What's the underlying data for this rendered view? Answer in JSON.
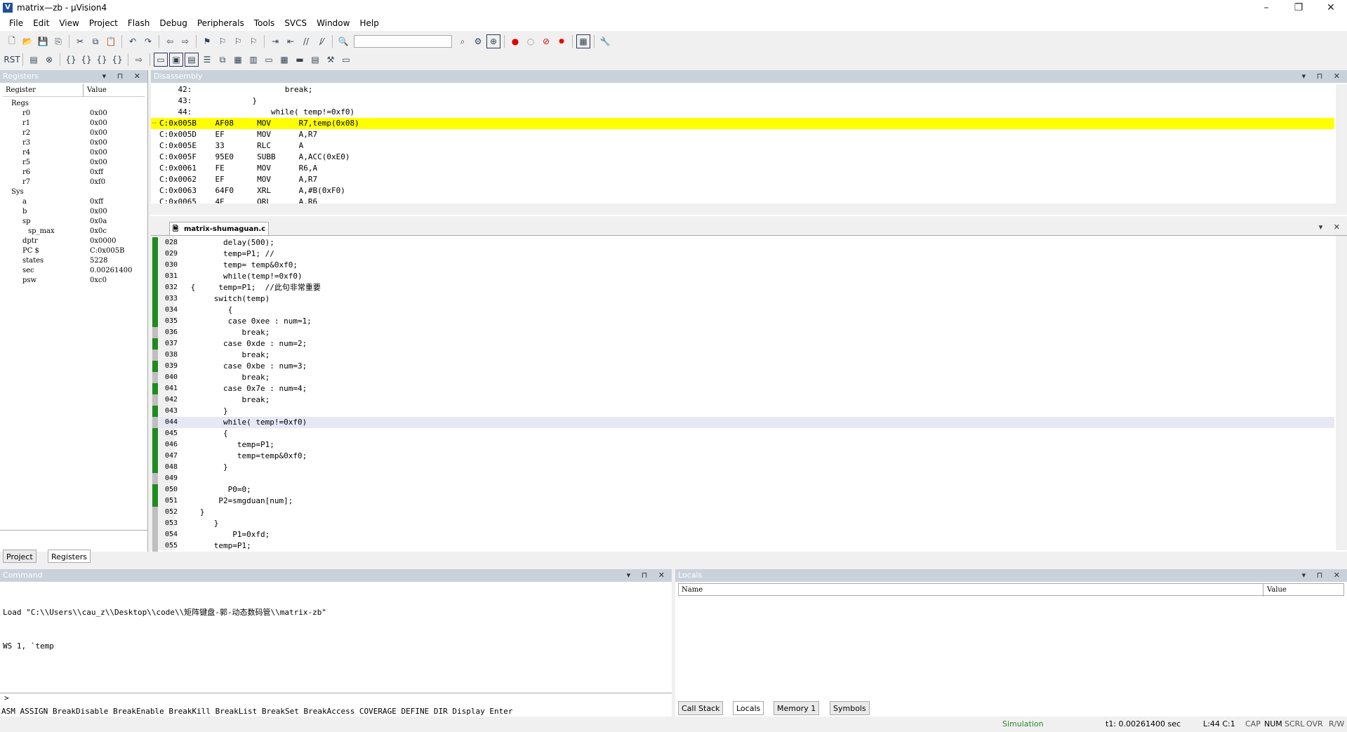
{
  "window": {
    "title": "matrix—zb - µVision4"
  },
  "menu": [
    "File",
    "Edit",
    "View",
    "Project",
    "Flash",
    "Debug",
    "Peripherals",
    "Tools",
    "SVCS",
    "Window",
    "Help"
  ],
  "registers": {
    "header": "Registers",
    "col_register": "Register",
    "col_value": "Value",
    "rows": [
      {
        "name": "Regs",
        "value": "",
        "indent": 1,
        "group": true
      },
      {
        "name": "r0",
        "value": "0x00",
        "indent": 3
      },
      {
        "name": "r1",
        "value": "0x00",
        "indent": 3
      },
      {
        "name": "r2",
        "value": "0x00",
        "indent": 3
      },
      {
        "name": "r3",
        "value": "0x00",
        "indent": 3
      },
      {
        "name": "r4",
        "value": "0x00",
        "indent": 3
      },
      {
        "name": "r5",
        "value": "0x00",
        "indent": 3
      },
      {
        "name": "r6",
        "value": "0xff",
        "indent": 3
      },
      {
        "name": "r7",
        "value": "0xf0",
        "indent": 3
      },
      {
        "name": "Sys",
        "value": "",
        "indent": 1,
        "group": true
      },
      {
        "name": "a",
        "value": "0xff",
        "indent": 3
      },
      {
        "name": "b",
        "value": "0x00",
        "indent": 3
      },
      {
        "name": "sp",
        "value": "0x0a",
        "indent": 3
      },
      {
        "name": "sp_max",
        "value": "0x0c",
        "indent": 4
      },
      {
        "name": "dptr",
        "value": "0x0000",
        "indent": 3
      },
      {
        "name": "PC  $",
        "value": "C:0x005B",
        "indent": 3
      },
      {
        "name": "states",
        "value": "5228",
        "indent": 3
      },
      {
        "name": "sec",
        "value": "0.00261400",
        "indent": 3
      },
      {
        "name": "psw",
        "value": "0xc0",
        "indent": 3
      }
    ],
    "tabs": [
      "Project",
      "Registers"
    ]
  },
  "disassembly": {
    "header": "Disassembly",
    "lines": [
      {
        "text": "    42:                    break;",
        "hl": false
      },
      {
        "text": "    43:             }",
        "hl": false
      },
      {
        "text": "    44:                 while( temp!=0xf0)",
        "hl": false
      },
      {
        "text": "C:0x005B    AF08     MOV      R7,temp(0x08)",
        "hl": true
      },
      {
        "text": "C:0x005D    EF       MOV      A,R7",
        "hl": false
      },
      {
        "text": "C:0x005E    33       RLC      A",
        "hl": false
      },
      {
        "text": "C:0x005F    95E0     SUBB     A,ACC(0xE0)",
        "hl": false
      },
      {
        "text": "C:0x0061    FE       MOV      R6,A",
        "hl": false
      },
      {
        "text": "C:0x0062    EF       MOV      A,R7",
        "hl": false
      },
      {
        "text": "C:0x0063    64F0     XRL      A,#B(0xF0)",
        "hl": false
      },
      {
        "text": "C:0x0065    4E       ORL      A,R6",
        "hl": false
      }
    ]
  },
  "editor": {
    "tab": "matrix-shumaguan.c",
    "lines": [
      {
        "n": "028",
        "code": "        delay(500);"
      },
      {
        "n": "029",
        "code": "        temp=P1; //"
      },
      {
        "n": "030",
        "code": "        temp= temp&0xf0;"
      },
      {
        "n": "031",
        "code": "        while(temp!=0xf0)"
      },
      {
        "n": "032",
        "code": " {     temp=P1;  //此句非常重要"
      },
      {
        "n": "033",
        "code": "      switch(temp)"
      },
      {
        "n": "034",
        "code": "         {"
      },
      {
        "n": "035",
        "code": "         case 0xee : num=1;"
      },
      {
        "n": "036",
        "code": "            break;"
      },
      {
        "n": "037",
        "code": "        case 0xde : num=2;"
      },
      {
        "n": "038",
        "code": "            break;"
      },
      {
        "n": "039",
        "code": "        case 0xbe : num=3;"
      },
      {
        "n": "040",
        "code": "            break;"
      },
      {
        "n": "041",
        "code": "        case 0x7e : num=4;"
      },
      {
        "n": "042",
        "code": "            break;"
      },
      {
        "n": "043",
        "code": "        }"
      },
      {
        "n": "044",
        "code": "        while( temp!=0xf0)"
      },
      {
        "n": "045",
        "code": "        {"
      },
      {
        "n": "046",
        "code": "           temp=P1;"
      },
      {
        "n": "047",
        "code": "           temp=temp&0xf0;"
      },
      {
        "n": "048",
        "code": "        }"
      },
      {
        "n": "049",
        "code": ""
      },
      {
        "n": "050",
        "code": "         P0=0;"
      },
      {
        "n": "051",
        "code": "       P2=smgduan[num];"
      },
      {
        "n": "052",
        "code": "   }"
      },
      {
        "n": "053",
        "code": "      }"
      },
      {
        "n": "054",
        "code": "          P1=0xfd;"
      },
      {
        "n": "055",
        "code": "      temp=P1;"
      }
    ]
  },
  "command": {
    "header": "Command",
    "lines": [
      "Load \"C:\\\\Users\\\\cau_z\\\\Desktop\\\\code\\\\矩阵键盘-郭-动态数码管\\\\matrix-zb\"",
      "WS 1, `temp"
    ],
    "prompt": ">",
    "hints": "ASM ASSIGN BreakDisable BreakEnable BreakKill BreakList BreakSet BreakAccess COVERAGE DEFINE DIR Display Enter"
  },
  "locals": {
    "header": "Locals",
    "col_name": "Name",
    "col_value": "Value",
    "tabs": [
      "Call Stack",
      "Locals",
      "Memory 1",
      "Symbols"
    ]
  },
  "status": {
    "mode": "Simulation",
    "time": "t1: 0.00261400 sec",
    "pos": "L:44 C:1",
    "flags": [
      "CAP",
      "NUM",
      "SCRL",
      "OVR",
      "R/W"
    ]
  }
}
